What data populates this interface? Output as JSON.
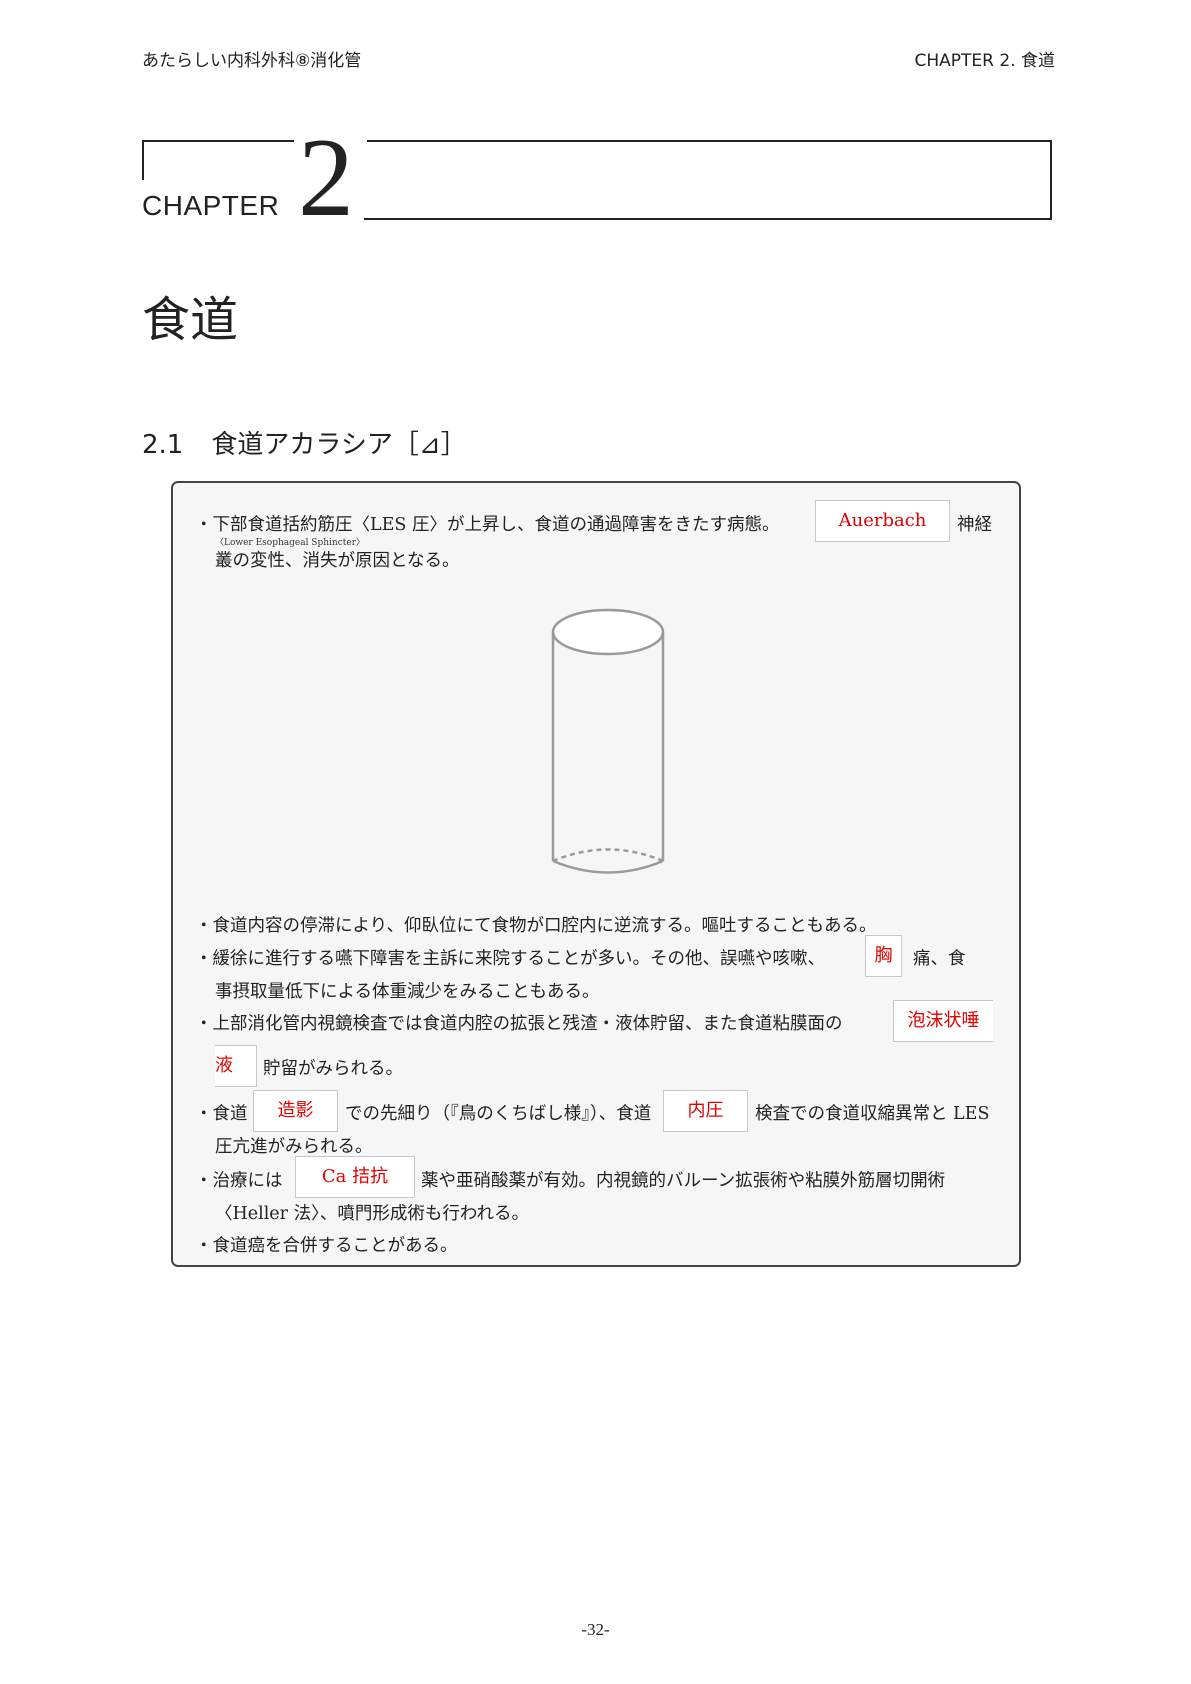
{
  "header": {
    "left": "あたらしい内科外科⑧消化管",
    "right": "CHAPTER  2.  食道"
  },
  "chapter": {
    "label": "CHAPTER",
    "number": "2",
    "title": "食道"
  },
  "section": {
    "number": "2.1",
    "title": "食道アカラシア［⊿］"
  },
  "card": {
    "p1": {
      "l1_text": "・下部食道括約筋圧〈LES 圧〉が上昇し、食道の通過障害をきたす病態。",
      "ruby": "〈Lower Esophageal Sphincter〉",
      "blank": "Auerbach",
      "l1_after": "神経",
      "l2": "叢の変性、消失が原因となる。"
    },
    "p2": "・食道内容の停滞により、仰臥位にて食物が口腔内に逆流する。嘔吐することもある。",
    "p3": {
      "l1_before": "・緩徐に進行する嚥下障害を主訴に来院することが多い。その他、誤嚥や咳嗽、",
      "blank": "胸",
      "l1_after": "痛、食",
      "l2": "事摂取量低下による体重減少をみることもある。"
    },
    "p4": {
      "l1_before": "・上部消化管内視鏡検査では食道内腔の拡張と残渣・液体貯留、また食道粘膜面の",
      "blank_a": "泡沫状唾",
      "blank_b": "液",
      "l2_after": "貯留がみられる。"
    },
    "p5": {
      "l1_a": "・食道",
      "blank_1": "造影",
      "l1_b": "での先細り（『鳥のくちばし様』）、食道",
      "blank_2": "内圧",
      "l1_c": "検査での食道収縮異常と LES",
      "l2": "圧亢進がみられる。"
    },
    "p6": {
      "l1_a": "・治療には",
      "blank": "Ca 拮抗",
      "l1_b": "薬や亜硝酸薬が有効。内視鏡的バルーン拡張術や粘膜外筋層切開術",
      "l2": "〈Heller 法〉、噴門形成術も行われる。"
    },
    "p7": "・食道癌を合併することがある。"
  },
  "page_number": "-32-"
}
